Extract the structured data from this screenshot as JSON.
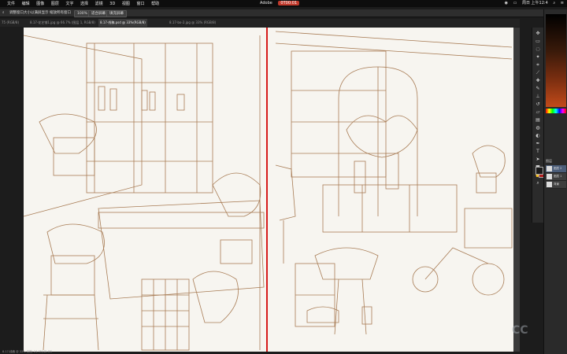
{
  "menubar": {
    "items": [
      "文件",
      "编辑",
      "图像",
      "图层",
      "文字",
      "选择",
      "滤镜",
      "3D",
      "视图",
      "窗口",
      "帮助"
    ],
    "center_items": [
      "Adobe"
    ],
    "recording_label": "0T00:01",
    "right_items": [
      "周日 上午12:4"
    ]
  },
  "options_bar": {
    "auto_select_label": "调整窗口大小以满屏显示",
    "zoom_all_label": "缩放所有窗口",
    "scrubby_label": "细微缩放",
    "zoom_value": "100%",
    "fit_screen_label": "适合屏幕",
    "fill_screen_label": "填充屏幕"
  },
  "tabs": [
    {
      "label": "75 (RGB/8)"
    },
    {
      "label": "8.17-花艺铺1.jpg @ 66.7% (图层 1, RGB/8)"
    },
    {
      "label": "8.17-线稿.psd @ 33%(RGB/8)",
      "active": true
    },
    {
      "label": "8.17-bo-2.jpg @ 33% (RGB/8)"
    }
  ],
  "layers_panel": {
    "title": "图层",
    "layers": [
      "图层 2",
      "图层 1",
      "背景"
    ]
  },
  "status_bar": {
    "text": "8.17-线稿 @ 33% 文档: 24.3M/48.6M"
  },
  "watermark": {
    "text": "CC"
  },
  "colors": {
    "divider": "#d61b1b",
    "line_art": "#a87c55",
    "canvas_bg": "#f7f5f0"
  },
  "tools": [
    "move-icon",
    "marquee-icon",
    "lasso-icon",
    "magic-wand-icon",
    "crop-icon",
    "eyedropper-icon",
    "healing-icon",
    "brush-icon",
    "stamp-icon",
    "history-brush-icon",
    "eraser-icon",
    "gradient-icon",
    "blur-icon",
    "dodge-icon",
    "pen-icon",
    "type-icon",
    "path-select-icon",
    "shape-icon",
    "hand-icon",
    "zoom-icon"
  ]
}
